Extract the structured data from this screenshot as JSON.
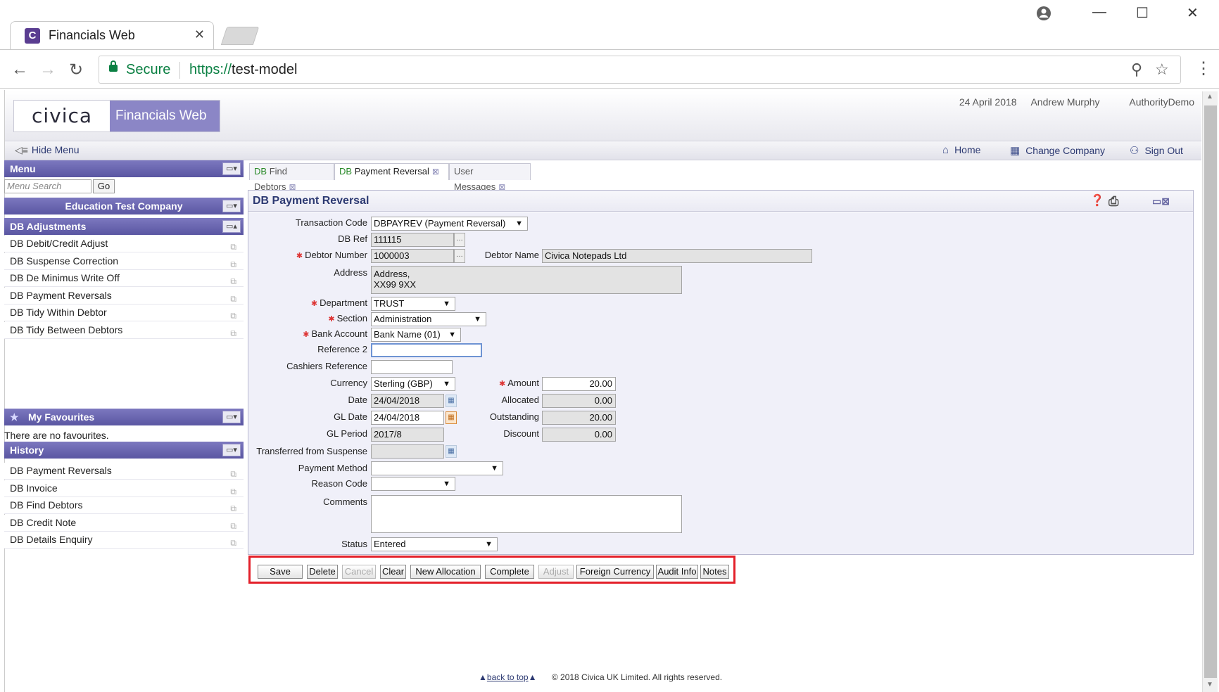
{
  "browser": {
    "tab_title": "Financials Web",
    "tab_favicon": "C",
    "secure_label": "Secure",
    "url_scheme": "https://",
    "url_host": "test-model"
  },
  "header": {
    "logo": "civica",
    "product": "Financials Web",
    "date": "24 April 2018",
    "user": "Andrew Murphy",
    "authority": "AuthorityDemo"
  },
  "menubar": {
    "hide_menu": "Hide Menu",
    "home": "Home",
    "change_company": "Change Company",
    "sign_out": "Sign Out"
  },
  "sidebar": {
    "menu_title": "Menu",
    "search_placeholder": "Menu Search",
    "go": "Go",
    "company": "Education Test Company",
    "section": "DB Adjustments",
    "items": [
      "DB Debit/Credit Adjust",
      "DB Suspense Correction",
      "DB De Minimus Write Off",
      "DB Payment Reversals",
      "DB Tidy Within Debtor",
      "DB Tidy Between Debtors"
    ],
    "favourites_title": "My Favourites",
    "favourites_empty": "There are no favourites.",
    "history_title": "History",
    "history": [
      "DB Payment Reversals",
      "DB Invoice",
      "DB Find Debtors",
      "DB Credit Note",
      "DB Details Enquiry"
    ]
  },
  "tabs": [
    {
      "prefix": "DB",
      "label": "Find Debtors"
    },
    {
      "prefix": "DB",
      "label": "Payment Reversal"
    },
    {
      "prefix": "",
      "label": "User Messages"
    }
  ],
  "form": {
    "title": "DB Payment Reversal",
    "labels": {
      "transaction_code": "Transaction Code",
      "db_ref": "DB Ref",
      "debtor_number": "Debtor Number",
      "debtor_name": "Debtor Name",
      "address": "Address",
      "department": "Department",
      "section": "Section",
      "bank_account": "Bank Account",
      "reference2": "Reference 2",
      "cashiers_reference": "Cashiers Reference",
      "currency": "Currency",
      "amount": "Amount",
      "date": "Date",
      "allocated": "Allocated",
      "gl_date": "GL Date",
      "outstanding": "Outstanding",
      "gl_period": "GL Period",
      "discount": "Discount",
      "transferred": "Transferred from Suspense",
      "payment_method": "Payment Method",
      "reason_code": "Reason Code",
      "comments": "Comments",
      "status": "Status"
    },
    "values": {
      "transaction_code": "DBPAYREV (Payment Reversal)",
      "db_ref": "111115",
      "debtor_number": "1000003",
      "debtor_name": "Civica Notepads Ltd",
      "address_line1": "Address,",
      "address_line2": "XX99 9XX",
      "department": "TRUST",
      "section": "Administration",
      "bank_account": "Bank Name (01)",
      "reference2": "",
      "cashiers_reference": "",
      "currency": "Sterling (GBP)",
      "amount": "20.00",
      "date": "24/04/2018",
      "allocated": "0.00",
      "gl_date": "24/04/2018",
      "outstanding": "20.00",
      "gl_period": "2017/8",
      "discount": "0.00",
      "transferred": "",
      "payment_method": "",
      "reason_code": "",
      "comments": "",
      "status": "Entered"
    }
  },
  "buttons": {
    "save": "Save",
    "delete": "Delete",
    "cancel": "Cancel",
    "clear": "Clear",
    "new_allocation": "New Allocation",
    "complete": "Complete",
    "adjust": "Adjust",
    "foreign_currency": "Foreign Currency",
    "audit_info": "Audit Info",
    "notes": "Notes"
  },
  "footer": {
    "back_to_top": "back to top",
    "copyright": "© 2018 Civica UK Limited. All rights reserved."
  },
  "colors": {
    "accent": "#5a56a2",
    "highlight_box": "#e3202a",
    "secure_green": "#0b8043"
  }
}
